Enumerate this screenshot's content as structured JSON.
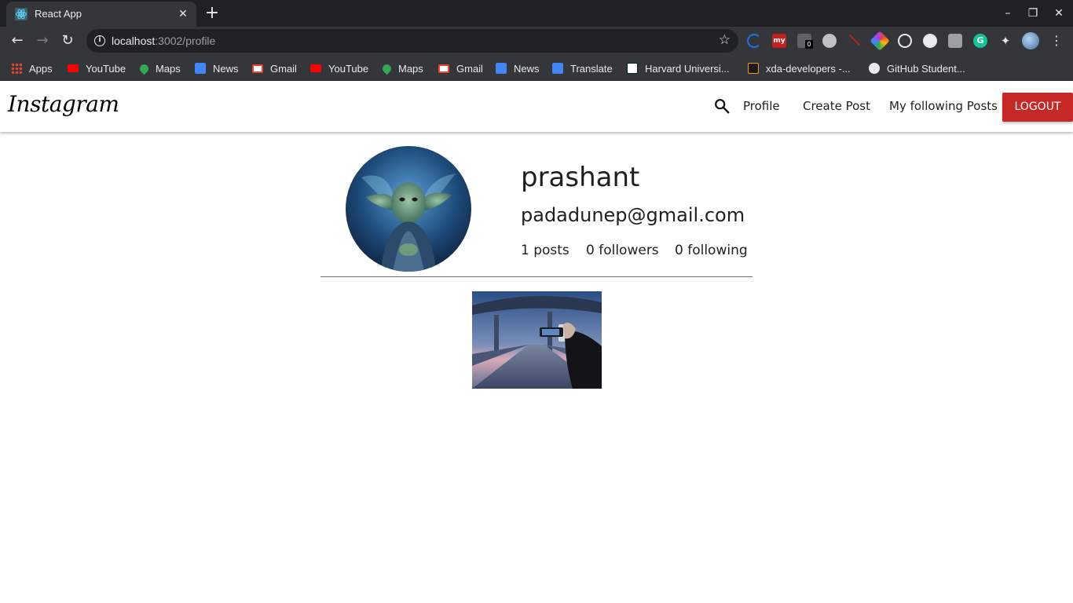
{
  "browser": {
    "tab_title": "React App",
    "tab_close": "✕",
    "new_tab": "+",
    "url_host": "localhost",
    "url_path": ":3002/profile",
    "window_controls": [
      "–",
      "❐",
      "✕"
    ],
    "nav": {
      "back": "←",
      "forward": "→",
      "reload": "↻"
    },
    "star": "☆"
  },
  "bookmarks": [
    {
      "label": "Apps",
      "icon": "apps-grid-icon",
      "color": "#ea4335"
    },
    {
      "label": "YouTube",
      "icon": "youtube-icon",
      "color": "#ff0000"
    },
    {
      "label": "Maps",
      "icon": "maps-icon",
      "color": "#34a853"
    },
    {
      "label": "News",
      "icon": "google-news-icon",
      "color": "#4285f4"
    },
    {
      "label": "Gmail",
      "icon": "gmail-icon",
      "color": "#ea4335"
    },
    {
      "label": "YouTube",
      "icon": "youtube-icon",
      "color": "#ff0000"
    },
    {
      "label": "Maps",
      "icon": "maps-icon",
      "color": "#34a853"
    },
    {
      "label": "Gmail",
      "icon": "gmail-icon",
      "color": "#ea4335"
    },
    {
      "label": "News",
      "icon": "google-news-icon",
      "color": "#4285f4"
    },
    {
      "label": "Translate",
      "icon": "translate-icon",
      "color": "#4285f4"
    },
    {
      "label": "Harvard Universi...",
      "icon": "edx-icon",
      "color": "#ffffff"
    },
    {
      "label": "xda-developers -...",
      "icon": "xda-icon",
      "color": "#f59714"
    },
    {
      "label": "GitHub Student...",
      "icon": "github-icon",
      "color": "#e8eaed"
    }
  ],
  "app": {
    "brand": "Instagram",
    "nav_links": [
      "Profile",
      "Create Post",
      "My following Posts"
    ],
    "logout": "LOGOUT"
  },
  "profile": {
    "name": "prashant",
    "email": "padadunep@gmail.com",
    "posts": "1 posts",
    "followers": "0 followers",
    "following": "0 following"
  },
  "colors": {
    "logout_bg": "#c62828",
    "chrome_dark": "#202124",
    "chrome_mid": "#35363a"
  }
}
